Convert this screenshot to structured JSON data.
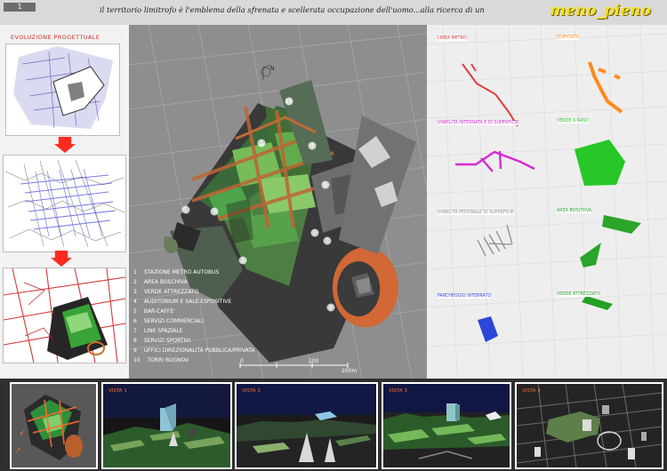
{
  "header": {
    "top_mark": "1",
    "headline": "il territorio limitrofo è l'emblema della sfrenata e scellerata occupazione dell'uomo...alla ricerca di un",
    "logo": "meno_pieno"
  },
  "left": {
    "title": "EVOLUZIONE PROGETTUALE"
  },
  "legend": [
    {
      "num": "1",
      "label": "STAZIONE METRO AUTOBUS"
    },
    {
      "num": "2",
      "label": "AREA BOSCHIVA"
    },
    {
      "num": "3",
      "label": "VERDE ATTREZZATO"
    },
    {
      "num": "4",
      "label": "AUDITORIUM E SALE ESPOSITIVE"
    },
    {
      "num": "5",
      "label": "BAR-CAFFE'"
    },
    {
      "num": "6",
      "label": "SERVIZI COMMERCIALI"
    },
    {
      "num": "7",
      "label": "LINK SPAZIALE"
    },
    {
      "num": "8",
      "label": "SERVIZI SPORTIVI"
    },
    {
      "num": "9",
      "label": "UFFICI DIREZIONALITÀ PUBBLICA/PRIVATA"
    },
    {
      "num": "10",
      "label": "TORRI BUGNOV"
    }
  ],
  "scale": {
    "mid": "100",
    "end": "200m"
  },
  "right_cards": [
    {
      "label": "LINEA METRO",
      "color": "#e23d3d"
    },
    {
      "label": "EDIFICATO",
      "color": "#ff8a1a"
    },
    {
      "label": "VIABILITÀ INTERNATA E DI SUPERFICIE",
      "color": "#d42ad4"
    },
    {
      "label": "VERDE A RASO",
      "color": "#27c727"
    },
    {
      "label": "VIABILITÀ PEDONALE DI SUPERFICIE",
      "color": "#8c8c8c"
    },
    {
      "label": "AREA BOSCHIVA",
      "color": "#2aa52a"
    },
    {
      "label": "PARCHEGGIO INTERRATO",
      "color": "#2c46d8"
    },
    {
      "label": "VERDE ATTREZZATO",
      "color": "#24a024"
    }
  ],
  "bottom": {
    "renders": [
      {
        "label": "VISTA 1"
      },
      {
        "label": "VISTA 2"
      },
      {
        "label": "VISTA 3"
      },
      {
        "label": "VISTA 4"
      }
    ]
  },
  "colors": {
    "topbar": "#d9d9d9",
    "logo": "#f6e11a",
    "title_red": "#ca2f2f",
    "map_grey": "#8e8e8e"
  }
}
